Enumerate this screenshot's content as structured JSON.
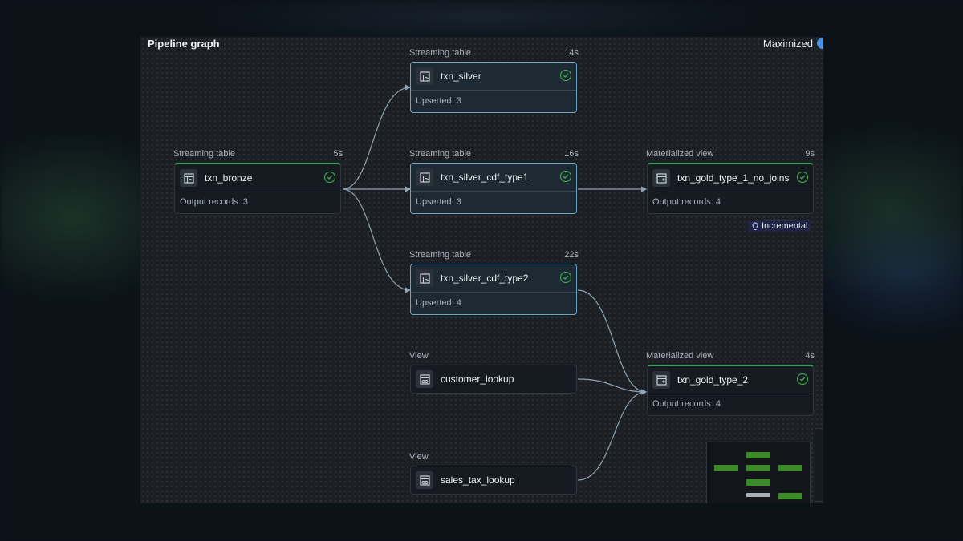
{
  "header": {
    "title": "Pipeline graph",
    "mode_label": "Maximized"
  },
  "nodes": [
    {
      "id": "bronze",
      "type": "Streaming table",
      "duration": "5s",
      "name": "txn_bronze",
      "metric": "Output records: 3",
      "status": "success-icon"
    },
    {
      "id": "silver",
      "type": "Streaming table",
      "duration": "14s",
      "name": "txn_silver",
      "metric": "Upserted: 3",
      "status": "success-icon"
    },
    {
      "id": "cdf1",
      "type": "Streaming table",
      "duration": "16s",
      "name": "txn_silver_cdf_type1",
      "metric": "Upserted: 3",
      "status": "success-icon"
    },
    {
      "id": "cdf2",
      "type": "Streaming table",
      "duration": "22s",
      "name": "txn_silver_cdf_type2",
      "metric": "Upserted: 4",
      "status": "success-icon"
    },
    {
      "id": "gold1",
      "type": "Materialized view",
      "duration": "9s",
      "name": "txn_gold_type_1_no_joins",
      "metric": "Output records: 4",
      "status": "success-icon"
    },
    {
      "id": "gold2",
      "type": "Materialized view",
      "duration": "4s",
      "name": "txn_gold_type_2",
      "metric": "Output records: 4",
      "status": "success-icon"
    },
    {
      "id": "cust",
      "type": "View",
      "duration": "",
      "name": "customer_lookup",
      "metric": "",
      "status": ""
    },
    {
      "id": "tax",
      "type": "View",
      "duration": "",
      "name": "sales_tax_lookup",
      "metric": "",
      "status": ""
    }
  ],
  "badge": {
    "label": "Incremental",
    "icon": "lightbulb-icon"
  },
  "colors": {
    "accent_green": "#3fb950",
    "selected_border": "#6aa6c8",
    "edge": "#8fa3b5",
    "minimap_green": "#3a8a27"
  }
}
